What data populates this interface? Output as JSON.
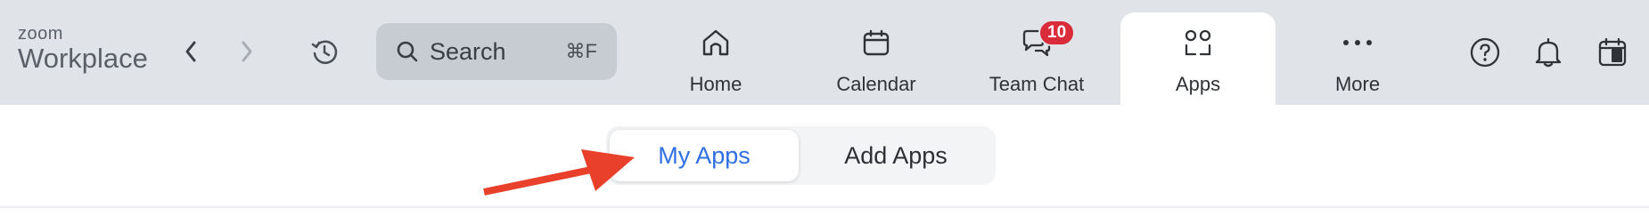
{
  "app": {
    "logo_top": "zoom",
    "logo_main": "Workplace"
  },
  "search": {
    "label": "Search",
    "shortcut": "⌘F"
  },
  "tabs": [
    {
      "label": "Home",
      "icon": "home-icon"
    },
    {
      "label": "Calendar",
      "icon": "calendar-icon"
    },
    {
      "label": "Team Chat",
      "icon": "chat-icon",
      "badge": "10"
    },
    {
      "label": "Apps",
      "icon": "apps-icon",
      "active": true
    },
    {
      "label": "More",
      "icon": "more-icon"
    }
  ],
  "subtabs": {
    "my_apps": "My Apps",
    "add_apps": "Add Apps",
    "active": "My Apps"
  },
  "colors": {
    "accent": "#2f6fe4",
    "badge": "#d92b3a",
    "annotation_arrow": "#e8402a",
    "topbar": "#e0e3e8"
  }
}
